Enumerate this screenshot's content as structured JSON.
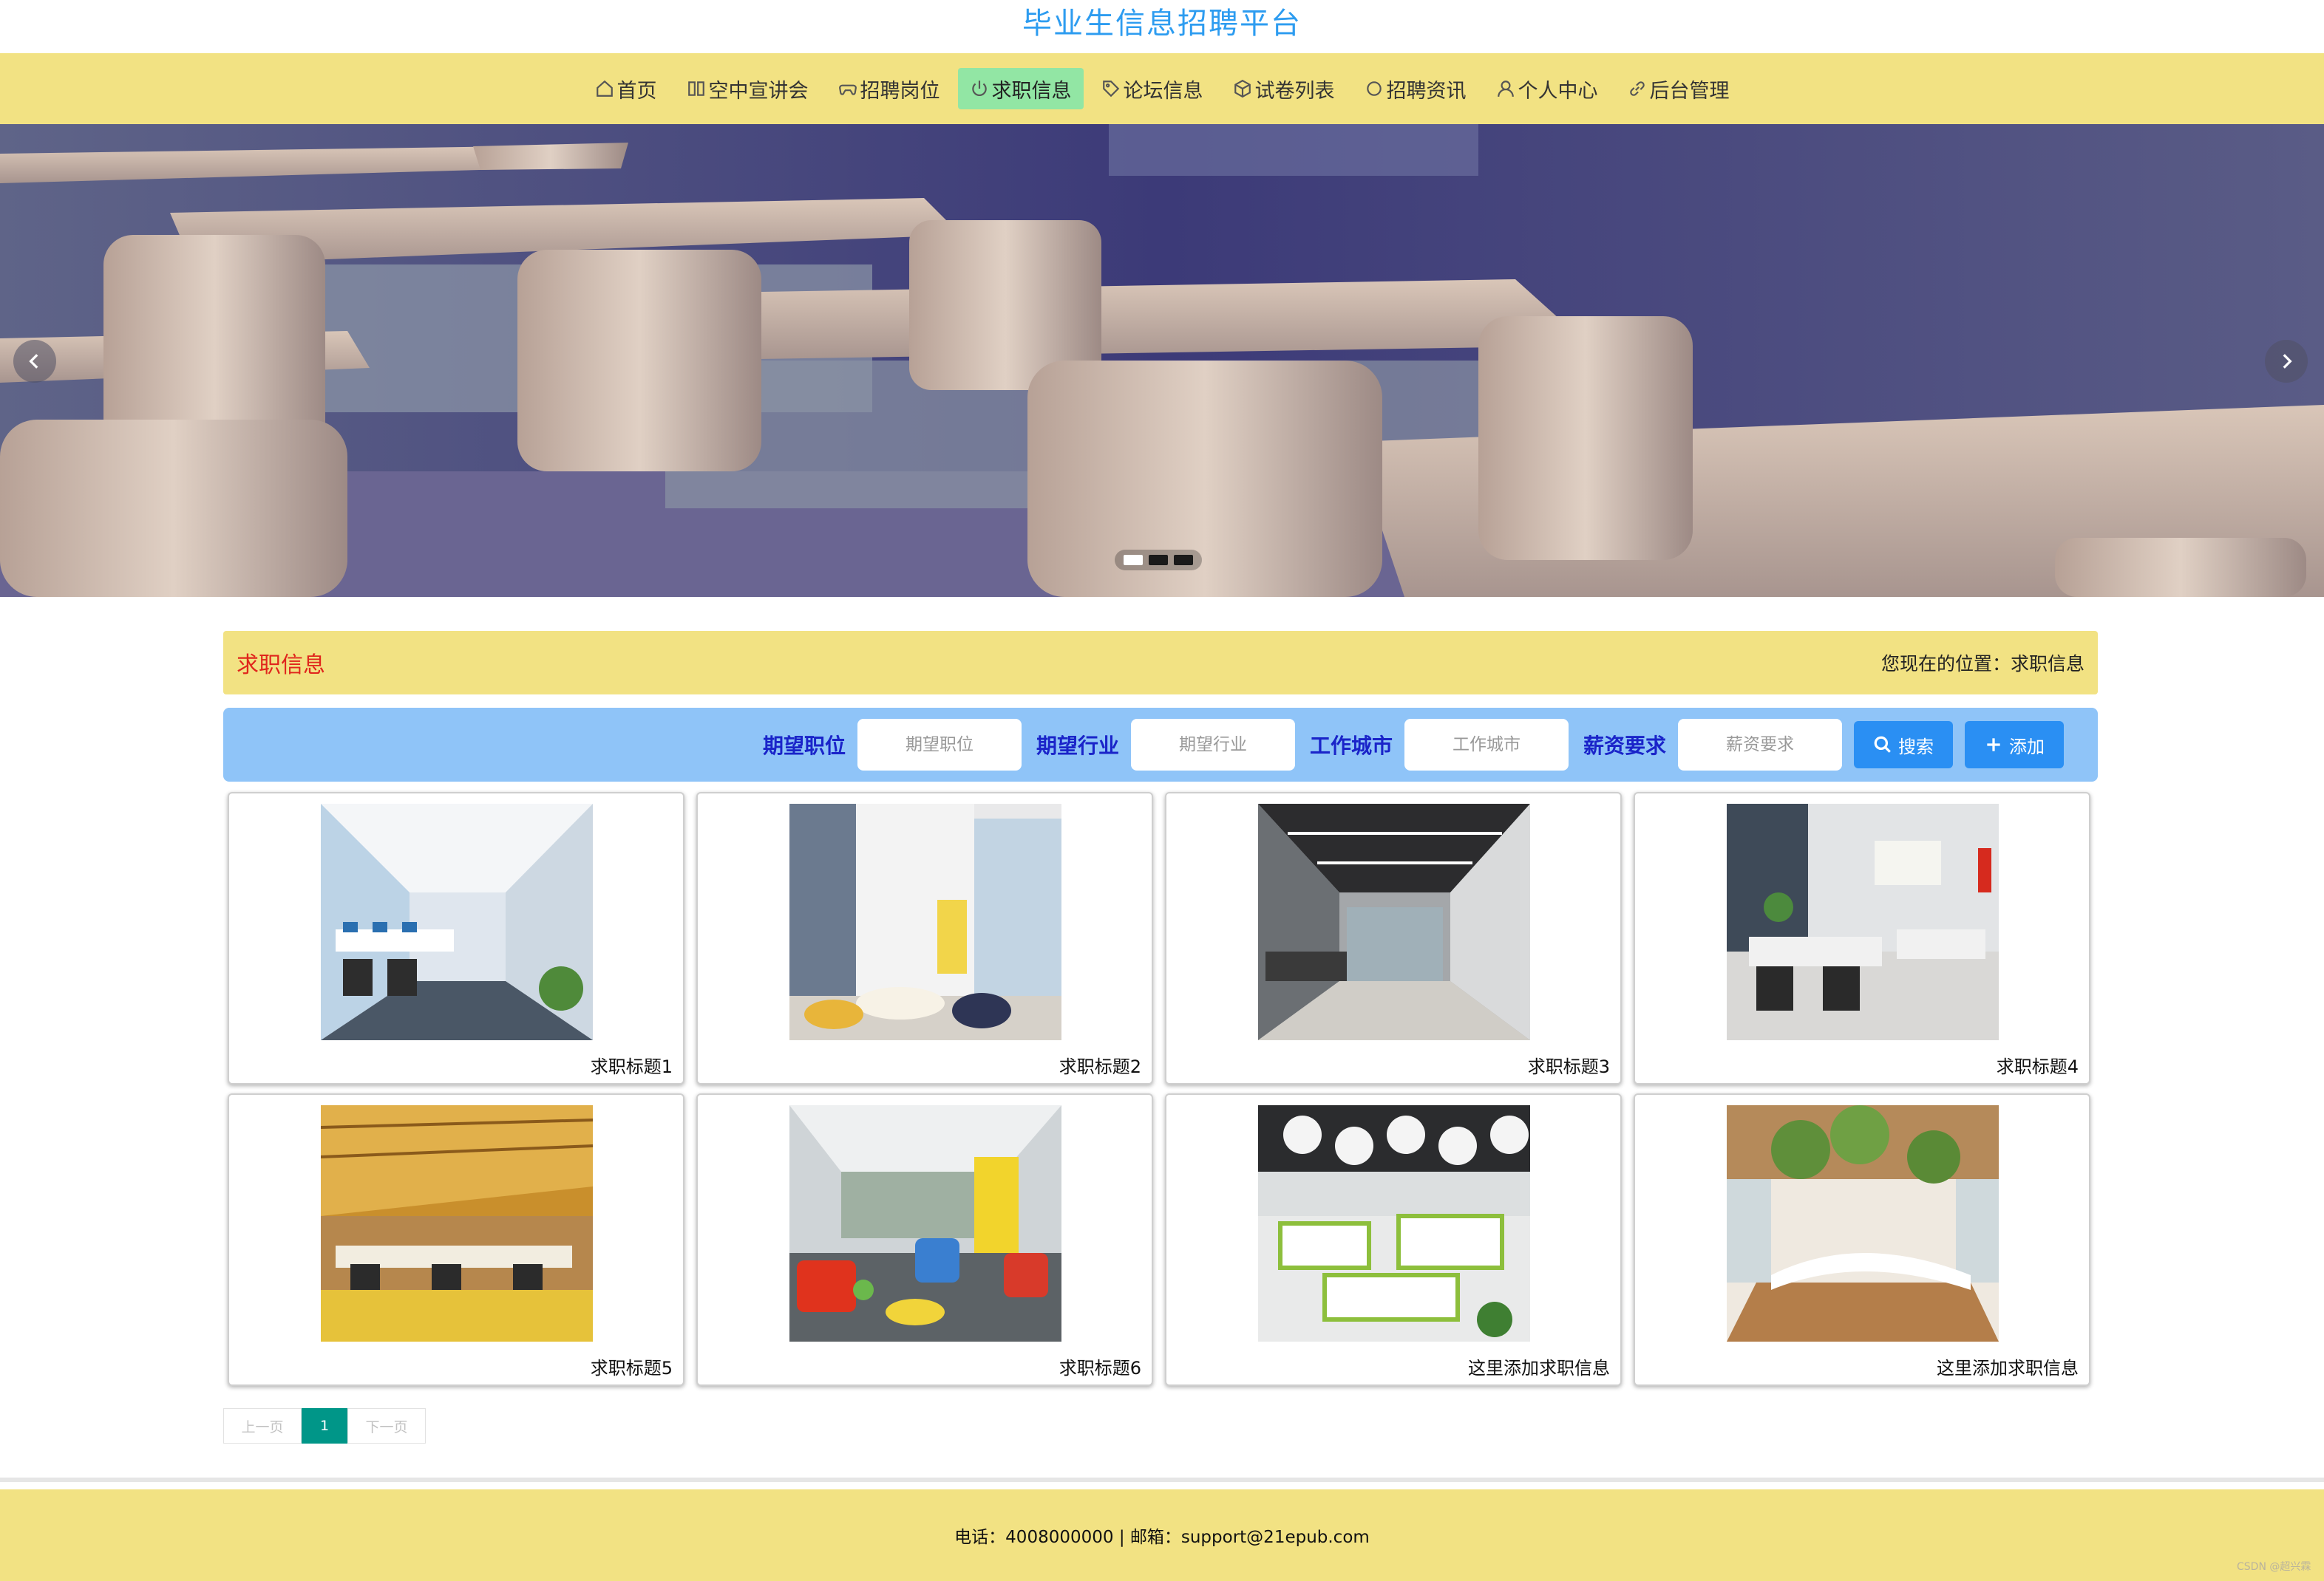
{
  "site": {
    "title": "毕业生信息招聘平台"
  },
  "nav": {
    "items": [
      {
        "label": "首页",
        "icon": "home-icon"
      },
      {
        "label": "空中宣讲会",
        "icon": "columns-icon"
      },
      {
        "label": "招聘岗位",
        "icon": "gamepad-icon"
      },
      {
        "label": "求职信息",
        "icon": "power-icon",
        "active": true
      },
      {
        "label": "论坛信息",
        "icon": "tag-icon"
      },
      {
        "label": "试卷列表",
        "icon": "cube-icon"
      },
      {
        "label": "招聘资讯",
        "icon": "circle-icon"
      },
      {
        "label": "个人中心",
        "icon": "user-icon"
      },
      {
        "label": "后台管理",
        "icon": "link-icon"
      }
    ],
    "active_bg": "#92e6a4",
    "bar_bg": "#f2e283"
  },
  "banner": {
    "slide_count": 3,
    "active_slide": 1
  },
  "section": {
    "title": "求职信息",
    "breadcrumb": "您现在的位置：求职信息"
  },
  "search": {
    "fields": [
      {
        "label": "期望职位",
        "placeholder": "期望职位"
      },
      {
        "label": "期望行业",
        "placeholder": "期望行业"
      },
      {
        "label": "工作城市",
        "placeholder": "工作城市"
      },
      {
        "label": "薪资要求",
        "placeholder": "薪资要求"
      }
    ],
    "search_label": "搜索",
    "add_label": "添加"
  },
  "cards": [
    {
      "title": "求职标题1",
      "image": "office-photo-1"
    },
    {
      "title": "求职标题2",
      "image": "office-photo-2"
    },
    {
      "title": "求职标题3",
      "image": "office-photo-3"
    },
    {
      "title": "求职标题4",
      "image": "office-photo-4"
    },
    {
      "title": "求职标题5",
      "image": "office-photo-5"
    },
    {
      "title": "求职标题6",
      "image": "office-photo-6"
    },
    {
      "title": "这里添加求职信息",
      "image": "office-photo-7"
    },
    {
      "title": "这里添加求职信息",
      "image": "office-photo-8"
    }
  ],
  "pager": {
    "prev": "上一页",
    "current": "1",
    "next": "下一页"
  },
  "footer": {
    "text": "电话：4008000000 | 邮箱：support@21epub.com"
  },
  "watermark": "CSDN @超兴霖",
  "colors": {
    "accent_blue": "#2a8ff3",
    "title_red": "#e0251c",
    "label_blue": "#1a24c9",
    "pager_green": "#009688"
  }
}
